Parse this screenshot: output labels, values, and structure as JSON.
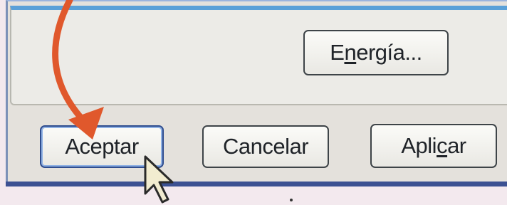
{
  "buttons": {
    "energia": {
      "before": "E",
      "underlined": "n",
      "after": "ergía..."
    },
    "aceptar": {
      "label": "Aceptar"
    },
    "cancelar": {
      "label": "Cancelar"
    },
    "aplicar": {
      "before": "Apli",
      "underlined": "c",
      "after": "ar"
    }
  },
  "annotation": {
    "arrow_color": "#e0582c"
  }
}
